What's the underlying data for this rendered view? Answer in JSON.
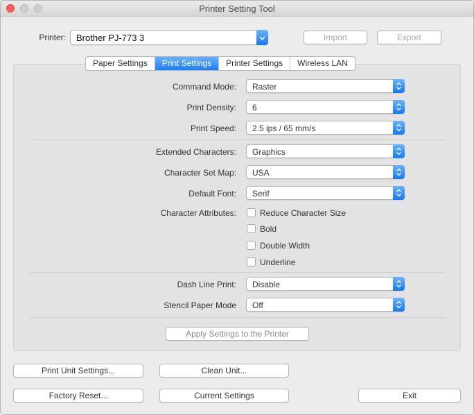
{
  "window": {
    "title": "Printer Setting Tool"
  },
  "printer": {
    "label": "Printer:",
    "selected": "Brother PJ-773 3"
  },
  "toolbar": {
    "import_label": "Import",
    "export_label": "Export"
  },
  "tabs": [
    {
      "label": "Paper Settings",
      "active": false
    },
    {
      "label": "Print Settings",
      "active": true
    },
    {
      "label": "Printer Settings",
      "active": false
    },
    {
      "label": "Wireless LAN",
      "active": false
    }
  ],
  "settings": {
    "command_mode": {
      "label": "Command Mode:",
      "value": "Raster"
    },
    "print_density": {
      "label": "Print Density:",
      "value": "6"
    },
    "print_speed": {
      "label": "Print Speed:",
      "value": "2.5 ips / 65 mm/s"
    },
    "extended_characters": {
      "label": "Extended Characters:",
      "value": "Graphics"
    },
    "character_set_map": {
      "label": "Character Set Map:",
      "value": "USA"
    },
    "default_font": {
      "label": "Default Font:",
      "value": "Serif"
    },
    "character_attributes": {
      "label": "Character Attributes:",
      "options": [
        {
          "label": "Reduce Character Size",
          "checked": false
        },
        {
          "label": "Bold",
          "checked": false
        },
        {
          "label": "Double Width",
          "checked": false
        },
        {
          "label": "Underline",
          "checked": false
        }
      ]
    },
    "dash_line_print": {
      "label": "Dash Line Print:",
      "value": "Disable"
    },
    "stencil_paper_mode": {
      "label": "Stencil Paper Mode",
      "value": "Off"
    },
    "apply_label": "Apply Settings to the Printer"
  },
  "bottom": {
    "print_unit_label": "Print Unit Settings...",
    "clean_unit_label": "Clean Unit...",
    "factory_reset_label": "Factory Reset...",
    "current_settings_label": "Current Settings",
    "exit_label": "Exit"
  },
  "colors": {
    "accent": "#1c7ef5",
    "close": "#fc5f57"
  }
}
